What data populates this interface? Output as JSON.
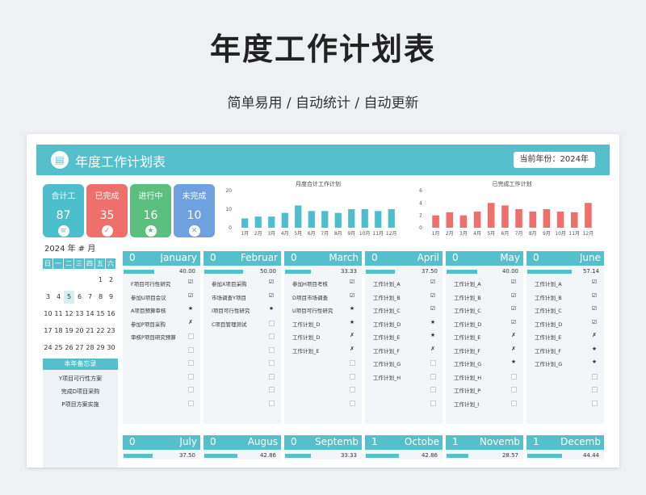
{
  "page_title": "年度工作计划表",
  "subtitle": "简单易用  /  自动统计  /  自动更新",
  "header": {
    "logo_icon": "clipboard-icon",
    "title": "年度工作计划表",
    "year_label": "当前年份：2024年"
  },
  "cards": [
    {
      "label": "合计工",
      "value": "87",
      "icon": "list-icon",
      "color": "#4dbfcc"
    },
    {
      "label": "已完成",
      "value": "35",
      "icon": "check-icon",
      "color": "#ee6f6c"
    },
    {
      "label": "进行中",
      "value": "16",
      "icon": "star-icon",
      "color": "#5bbf7d"
    },
    {
      "label": "未完成",
      "value": "10",
      "icon": "x-icon",
      "color": "#6fa0df"
    }
  ],
  "chart_data": [
    {
      "type": "bar",
      "title": "月度合计工作计划",
      "color": "#4dbfcc",
      "categories": [
        "1月",
        "2月",
        "3月",
        "4月",
        "5月",
        "6月",
        "7月",
        "8月",
        "9月",
        "10月",
        "11月",
        "12月"
      ],
      "values": [
        5,
        6,
        6,
        8,
        12,
        9,
        9,
        8,
        10,
        10,
        9,
        10
      ],
      "ylim": [
        0,
        20
      ],
      "yticks": [
        "0",
        "10",
        "20"
      ]
    },
    {
      "type": "bar",
      "title": "已完成工作计划",
      "color": "#ee6f6c",
      "categories": [
        "1月",
        "2月",
        "3月",
        "4月",
        "5月",
        "6月",
        "7月",
        "8月",
        "9月",
        "10月",
        "11月",
        "12月"
      ],
      "values": [
        2,
        2.5,
        2,
        2.6,
        4,
        3.6,
        3,
        2.6,
        3,
        2.6,
        2.5,
        4
      ],
      "ylim": [
        0,
        6
      ],
      "yticks": [
        "0",
        "2",
        "4",
        "6"
      ]
    }
  ],
  "calendar": {
    "title": "2024  年   #   月",
    "headers": [
      "日",
      "一",
      "二",
      "三",
      "四",
      "五",
      "六"
    ],
    "rows": [
      [
        "",
        "",
        "",
        "",
        "",
        "1",
        "2"
      ],
      [
        "3",
        "4",
        "5",
        "6",
        "7",
        "8",
        "9"
      ],
      [
        "10",
        "11",
        "12",
        "13",
        "14",
        "15",
        "16"
      ],
      [
        "17",
        "18",
        "19",
        "20",
        "21",
        "22",
        "23"
      ],
      [
        "24",
        "25",
        "26",
        "27",
        "28",
        "29",
        "30"
      ]
    ],
    "today": "5"
  },
  "memo": {
    "title": "本年备忘录",
    "items": [
      "Y项目可行性方案",
      "完成D项目采购",
      "P项目方案实施"
    ]
  },
  "months_top": [
    {
      "num": "0",
      "name": "January",
      "progress": "40.00",
      "pct": 0.4,
      "tasks": [
        {
          "name": "F项目可行性研究",
          "status": "☑"
        },
        {
          "name": "参加U项目会议",
          "status": "☑"
        },
        {
          "name": "A项目预算审核",
          "status": "★"
        },
        {
          "name": "参加P项目采购",
          "status": "✗"
        },
        {
          "name": "审核P项目研究预算",
          "status": ""
        },
        {
          "name": "",
          "status": ""
        },
        {
          "name": "",
          "status": ""
        },
        {
          "name": "",
          "status": ""
        },
        {
          "name": "",
          "status": ""
        },
        {
          "name": "",
          "status": ""
        }
      ]
    },
    {
      "num": "0",
      "name": "Februar",
      "progress": "50.00",
      "pct": 0.5,
      "tasks": [
        {
          "name": "参加X项目采购",
          "status": "☑"
        },
        {
          "name": "市场调查Y项目",
          "status": "☑"
        },
        {
          "name": "I项目可行性研究",
          "status": "★"
        },
        {
          "name": "C项目管理测试",
          "status": ""
        },
        {
          "name": "",
          "status": ""
        },
        {
          "name": "",
          "status": ""
        },
        {
          "name": "",
          "status": ""
        },
        {
          "name": "",
          "status": ""
        },
        {
          "name": "",
          "status": ""
        },
        {
          "name": "",
          "status": ""
        }
      ]
    },
    {
      "num": "0",
      "name": "March",
      "progress": "33.33",
      "pct": 0.3333,
      "tasks": [
        {
          "name": "参加H项目考核",
          "status": "☑"
        },
        {
          "name": "D项目市场调查",
          "status": "☑"
        },
        {
          "name": "U项目可行性研究",
          "status": "★"
        },
        {
          "name": "工作计划_D",
          "status": "★"
        },
        {
          "name": "工作计划_D",
          "status": "✗"
        },
        {
          "name": "工作计划_E",
          "status": "✗"
        },
        {
          "name": "",
          "status": ""
        },
        {
          "name": "",
          "status": ""
        },
        {
          "name": "",
          "status": ""
        },
        {
          "name": "",
          "status": ""
        }
      ]
    },
    {
      "num": "0",
      "name": "April",
      "progress": "37.50",
      "pct": 0.375,
      "tasks": [
        {
          "name": "工作计划_A",
          "status": "☑"
        },
        {
          "name": "工作计划_B",
          "status": "☑"
        },
        {
          "name": "工作计划_C",
          "status": "☑"
        },
        {
          "name": "工作计划_D",
          "status": "★"
        },
        {
          "name": "工作计划_E",
          "status": "★"
        },
        {
          "name": "工作计划_F",
          "status": "✗"
        },
        {
          "name": "工作计划_G",
          "status": ""
        },
        {
          "name": "工作计划_H",
          "status": ""
        },
        {
          "name": "",
          "status": ""
        },
        {
          "name": "",
          "status": ""
        }
      ]
    },
    {
      "num": "0",
      "name": "May",
      "progress": "40.00",
      "pct": 0.4,
      "tasks": [
        {
          "name": "工作计划_A",
          "status": "☑"
        },
        {
          "name": "工作计划_B",
          "status": "☑"
        },
        {
          "name": "工作计划_C",
          "status": "☑"
        },
        {
          "name": "工作计划_D",
          "status": "☑"
        },
        {
          "name": "工作计划_E",
          "status": "✗"
        },
        {
          "name": "工作计划_F",
          "status": "✗"
        },
        {
          "name": "工作计划_G",
          "status": "★"
        },
        {
          "name": "工作计划_H",
          "status": ""
        },
        {
          "name": "工作计划_P",
          "status": ""
        },
        {
          "name": "工作计划_I",
          "status": ""
        }
      ]
    },
    {
      "num": "0",
      "name": "June",
      "progress": "57.14",
      "pct": 0.5714,
      "tasks": [
        {
          "name": "工作计划_A",
          "status": "☑"
        },
        {
          "name": "工作计划_B",
          "status": "☑"
        },
        {
          "name": "工作计划_C",
          "status": "☑"
        },
        {
          "name": "工作计划_D",
          "status": "☑"
        },
        {
          "name": "工作计划_E",
          "status": "✗"
        },
        {
          "name": "工作计划_F",
          "status": "★"
        },
        {
          "name": "工作计划_G",
          "status": "★"
        },
        {
          "name": "",
          "status": ""
        },
        {
          "name": "",
          "status": ""
        },
        {
          "name": "",
          "status": ""
        }
      ]
    }
  ],
  "months_bottom": [
    {
      "num": "0",
      "name": "July",
      "progress": "37.50",
      "pct": 0.375
    },
    {
      "num": "0",
      "name": "Augus",
      "progress": "42.86",
      "pct": 0.4286
    },
    {
      "num": "0",
      "name": "Septemb",
      "progress": "33.33",
      "pct": 0.3333
    },
    {
      "num": "1",
      "name": "Octobe",
      "progress": "42.86",
      "pct": 0.4286
    },
    {
      "num": "1",
      "name": "Novemb",
      "progress": "28.57",
      "pct": 0.2857
    },
    {
      "num": "1",
      "name": "Decemb",
      "progress": "44.44",
      "pct": 0.4444
    }
  ]
}
